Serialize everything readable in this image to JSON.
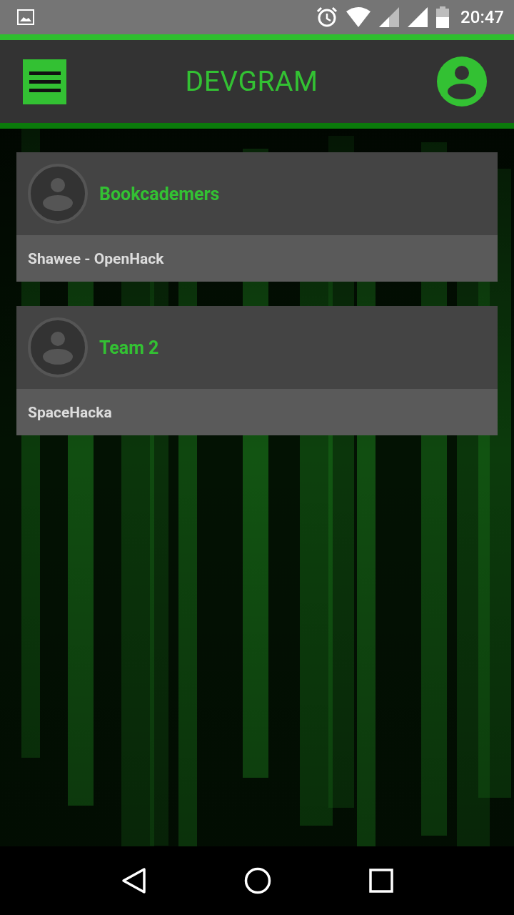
{
  "status_bar": {
    "time": "20:47"
  },
  "app_bar": {
    "title": "DEVGRAM"
  },
  "teams": [
    {
      "name": "Bookcademers",
      "project": "Shawee - OpenHack"
    },
    {
      "name": "Team 2",
      "project": "SpaceHacka"
    }
  ]
}
